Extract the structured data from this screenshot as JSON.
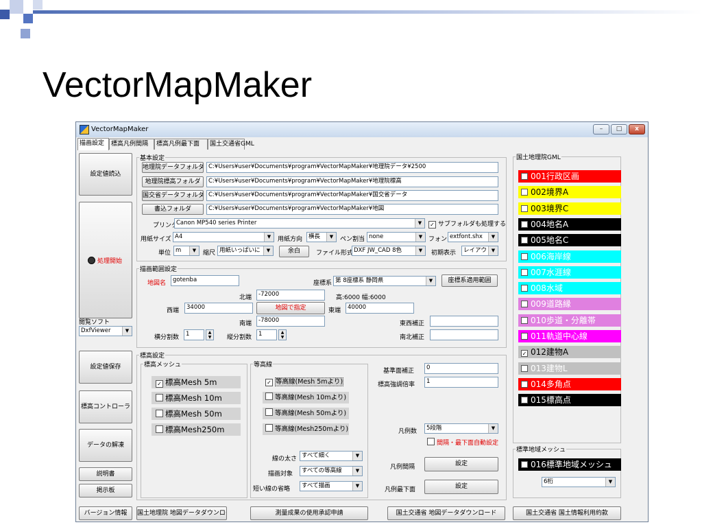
{
  "slide": {
    "title": "VectorMapMaker"
  },
  "window": {
    "title": "VectorMapMaker",
    "minimize": "–",
    "maximize": "□",
    "close": "x"
  },
  "tabs": [
    "描画設定",
    "標高凡例間隔",
    "標高凡例最下面",
    "国土交通省GML"
  ],
  "left": {
    "load_settings": "設定値読込",
    "process_start": "処理開始",
    "viewer_label": "閲覧ソフト",
    "viewer_value": "DxfViewer",
    "save_settings": "設定値保存",
    "elev_controller": "標高コントローラ",
    "data_extract": "データの解凍",
    "manual": "説明書",
    "bbs": "掲示板"
  },
  "basic": {
    "label": "基本設定",
    "folders": [
      {
        "button": "地理院データフォルダ",
        "path": "C:¥Users¥user¥Documents¥program¥VectorMapMaker¥地理院データ¥2500"
      },
      {
        "button": "地理院標高フォルダ",
        "path": "C:¥Users¥user¥Documents¥program¥VectorMapMaker¥地理院標高"
      },
      {
        "button": "国交省データフォルダ",
        "path": "C:¥Users¥user¥Documents¥program¥VectorMapMaker¥国交省データ"
      },
      {
        "button": "書込フォルダ",
        "path": "C:¥Users¥user¥Documents¥program¥VectorMapMaker¥地図"
      }
    ],
    "printer_label": "プリンタ",
    "printer_value": "Canon MP540 series Printer",
    "subfolder_check": "サブフォルダも処理する",
    "paper_label": "用紙サイズ",
    "paper_value": "A4",
    "orient_label": "用紙方向",
    "orient_value": "横長",
    "pen_label": "ペン割当",
    "pen_value": "none",
    "font_label": "フォント",
    "font_value": "extfont.shx",
    "unit_label": "単位",
    "unit_value": "m",
    "scale_label": "縮尺",
    "scale_value": "用紙いっぱいに",
    "margin_button": "余白",
    "format_label": "ファイル形式",
    "format_value": "DXF JW_CAD 8色",
    "initial_label": "初期表示",
    "initial_value": "レイアウト"
  },
  "range": {
    "label": "描画範囲設定",
    "mapname_label": "地図名",
    "mapname_value": "gotenba",
    "coord_label": "座標系",
    "coord_value": "第 8座標系 静岡県",
    "coord_button": "座標系適用範囲",
    "north_label": "北端",
    "north_value": "-72000",
    "size_text": "高:6000 幅:6000",
    "west_label": "西端",
    "west_value": "34000",
    "specify_button": "地図で指定",
    "east_label": "東端",
    "east_value": "40000",
    "south_label": "南端",
    "south_value": "-78000",
    "ew_corr_label": "東西補正",
    "ns_corr_label": "南北補正",
    "hdiv_label": "横分割数",
    "hdiv_value": "1",
    "vdiv_label": "縦分割数",
    "vdiv_value": "1"
  },
  "elev": {
    "label": "標高設定",
    "mesh_label": "標高メッシュ",
    "mesh": [
      {
        "label": "標高Mesh  5m",
        "checked": true
      },
      {
        "label": "標高Mesh 10m",
        "checked": false
      },
      {
        "label": "標高Mesh 50m",
        "checked": false
      },
      {
        "label": "標高Mesh250m",
        "checked": false
      }
    ],
    "contour_label": "等高線",
    "contours": [
      {
        "label": "等高線(Mesh  5mより)",
        "checked": true
      },
      {
        "label": "等高線(Mesh 10mより)",
        "checked": false
      },
      {
        "label": "等高線(Mesh 50mより)",
        "checked": false
      },
      {
        "label": "等高線(Mesh250mより)",
        "checked": false
      }
    ],
    "base_corr_label": "基準面補正",
    "base_corr_value": "0",
    "ratio_label": "標高強調倍率",
    "ratio_value": "1",
    "legend_count_label": "凡例数",
    "legend_count_value": "5段階",
    "auto_check": "間隔・最下面自動設定",
    "line_width_label": "線の太さ",
    "line_width_value": "すべて細く",
    "target_label": "描画対象",
    "target_value": "すべての等高線",
    "omit_label": "短い線の省略",
    "omit_value": "すべて描画",
    "interval_label": "凡例間隔",
    "interval_button": "設定",
    "bottom_label": "凡例最下面",
    "bottom_button": "設定"
  },
  "gml": {
    "label": "国土地理院GML",
    "layers": [
      {
        "label": "001行政区画",
        "bg": "#ff0000",
        "fg": "#ffffff"
      },
      {
        "label": "002境界A",
        "bg": "#ffff00",
        "fg": "#000000"
      },
      {
        "label": "003境界C",
        "bg": "#ffff00",
        "fg": "#000000"
      },
      {
        "label": "004地名A",
        "bg": "#000000",
        "fg": "#ffffff"
      },
      {
        "label": "005地名C",
        "bg": "#000000",
        "fg": "#ffffff"
      },
      {
        "label": "006海岸線",
        "bg": "#00ffff",
        "fg": "#ffffff"
      },
      {
        "label": "007水涯線",
        "bg": "#00ffff",
        "fg": "#ffffff"
      },
      {
        "label": "008水域",
        "bg": "#00ffff",
        "fg": "#ffffff"
      },
      {
        "label": "009道路縁",
        "bg": "#e080e0",
        "fg": "#ffffff"
      },
      {
        "label": "010歩道・分離帯",
        "bg": "#e080e0",
        "fg": "#ffffff"
      },
      {
        "label": "011軌道中心線",
        "bg": "#ff00ff",
        "fg": "#ffffff"
      },
      {
        "label": "012建物A",
        "bg": "#c0c0c0",
        "fg": "#000000",
        "checked": true
      },
      {
        "label": "013建物L",
        "bg": "#c0c0c0",
        "fg": "#ffffff"
      },
      {
        "label": "014多角点",
        "bg": "#ff0000",
        "fg": "#ffffff"
      },
      {
        "label": "015標高点",
        "bg": "#000000",
        "fg": "#ffffff"
      }
    ],
    "std_mesh_label": "標準地域メッシュ",
    "std_mesh": {
      "label": "016標準地域メッシュ",
      "bg": "#000000",
      "fg": "#ffffff"
    },
    "digits_value": "6桁"
  },
  "bottom": {
    "version": "バージョン情報",
    "gsi_download": "国土地理院  地図データダウンロード",
    "survey_apply": "測量成果の使用承認申請",
    "mlit_download": "国土交通省  地図データダウンロード",
    "mlit_terms": "国土交通省  国土情報利用約款"
  },
  "colors": {
    "deco_blue": "#4f6eb6",
    "deco_light": "#b5c3e3"
  }
}
